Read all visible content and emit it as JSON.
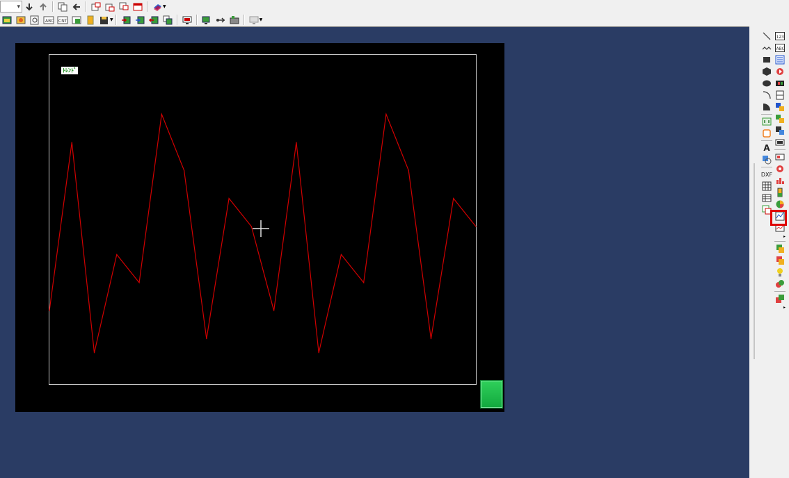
{
  "toolbar": {
    "combo_value": "",
    "row1_icons": [
      "arrow-down-icon",
      "arrow-up-icon",
      "copy-screen-icon",
      "arrow-left-icon",
      "window-a-icon",
      "window-b-icon",
      "window-c-icon",
      "window-d-icon",
      "layer-icon"
    ],
    "row2_icons": [
      "screen-open-icon",
      "screen-edit-icon",
      "preview-icon",
      "abc-icon",
      "cnt-icon",
      "window-screen-icon",
      "book-icon",
      "save-icon",
      "import-icon",
      "export-icon",
      "transfer-icon",
      "copy-transfer-icon",
      "monitor-icon",
      "network-icon",
      "usb-icon",
      "settings-icon"
    ]
  },
  "screen": {
    "trend_label": "ﾄﾚﾝﾄﾞ",
    "background": "#000000",
    "frame_color": "#c8c8c8",
    "line_color": "#d00000",
    "button_color": "#1fbf4c"
  },
  "chart_data": {
    "type": "line",
    "x": [
      0,
      1,
      2,
      3,
      4,
      5,
      6,
      7,
      8,
      9,
      10,
      11,
      12,
      13,
      14,
      15,
      16,
      17,
      18,
      19
    ],
    "series": [
      {
        "values": [
          20,
          80,
          5,
          40,
          30,
          90,
          70,
          10,
          60,
          50,
          20,
          80,
          5,
          40,
          30,
          90,
          70,
          10,
          60,
          50
        ]
      }
    ],
    "ylim": [
      0,
      100
    ],
    "grid": false
  },
  "palette": {
    "left_tools": [
      "line-icon",
      "polyline-icon",
      "rectangle-icon",
      "polygon-icon",
      "ellipse-icon",
      "arc-icon",
      "sector-icon",
      "bit-switch-icon",
      "frame-icon",
      "text-icon",
      "paint-icon",
      "dxf-icon",
      "table-icon",
      "grid-table-icon",
      "image-icon"
    ],
    "dxf_label": "DXF",
    "text_label": "A",
    "right_tools": [
      "numeric-display-icon",
      "abc-display-icon",
      "list-icon",
      "sound-icon",
      "video-icon",
      "panel-icon",
      "switch-icon",
      "lamp-icon",
      "keypad-icon",
      "alarm-icon",
      "history-icon",
      "recipe-icon",
      "bar-graph-icon",
      "pie-chart-icon",
      "trend-graph-icon",
      "line-graph-icon",
      "part-a-icon",
      "part-b-icon",
      "lightbulb-icon",
      "part-c-icon",
      "part-d-icon"
    ],
    "num_label": "123",
    "abc_label": "ABC"
  }
}
